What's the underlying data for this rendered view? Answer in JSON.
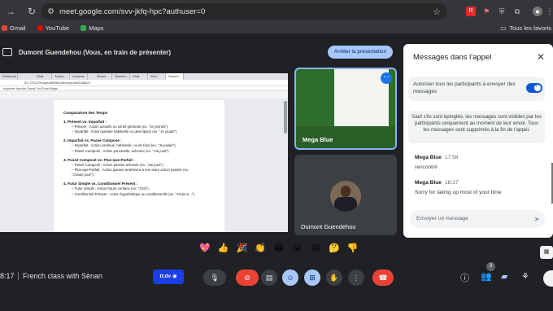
{
  "browser": {
    "url": "meet.google.com/svv-jkfq-hpc?authuser=0",
    "bookmarks": [
      {
        "label": "Gmail",
        "color": "#ea4335"
      },
      {
        "label": "YouTube",
        "color": "#ff0000"
      },
      {
        "label": "Maps",
        "color": "#34a853"
      }
    ],
    "all_bookmarks": "Tous les favoris"
  },
  "presentation": {
    "presenter_label": "Dumont Guendehou (Vous, en train de présenter)",
    "stop_button": "Arrêter la présentation"
  },
  "shared_screen": {
    "tabs": [
      "Dicebook",
      "Stud...",
      "Transl...",
      "Lessons",
      "Select...",
      "Speech...",
      "Stud...",
      "Intro",
      "Docs tr..."
    ],
    "mini_url": "ID=72IC57Ibuqes8lEfdbs3fcn4ysn5nf2Z8pluX",
    "mini_bookmarks": "Importer favoris   Gmail   YouTube   Maps",
    "doc_lines": [
      {
        "type": "h",
        "text": "Comparaison des Temps"
      },
      {
        "type": "h",
        "text": "1. Présent vs. Imparfait :"
      },
      {
        "type": "i",
        "text": "– Présent : Action actuelle ou vérité générale (ex. \"Je prends\")."
      },
      {
        "type": "i",
        "text": "– Imparfait : Action passée habituelle ou description (ex. \"Je jouais\")."
      },
      {
        "type": "h",
        "text": "2. Imparfait vs. Passé Composé :"
      },
      {
        "type": "i",
        "text": "– Imparfait : Action continue, habituelle, ou de fond (ex. \"Je jouais\")."
      },
      {
        "type": "i",
        "text": "– Passé Composé : Action ponctuelle, achevée (ex. \"J'ai joué\")."
      },
      {
        "type": "h",
        "text": "3. Passé Composé vs. Plus-que-Parfait :"
      },
      {
        "type": "i",
        "text": "– Passé Composé : Action passée achevée (ex. \"J'ai joué\")."
      },
      {
        "type": "i",
        "text": "– Plus-que-Parfait : Action passée antérieure à une autre action passée (ex."
      },
      {
        "type": "i",
        "text": "\"J'avais joué\")."
      },
      {
        "type": "h",
        "text": "4. Futur Simple vs. Conditionnel Présent :"
      },
      {
        "type": "i",
        "text": "– Futur Simple : Action future certaine (ex. \"J'irai\")."
      },
      {
        "type": "i",
        "text": "– Conditionnel Présent : Action hypothétique ou conditionnelle (ex. \"J'irais si...\")."
      }
    ]
  },
  "participants": [
    {
      "name": "Mega Blue"
    },
    {
      "name": "Dumont Guendehou"
    }
  ],
  "chat": {
    "title": "Messages dans l'appel",
    "toggle_label": "Autoriser tous les participants à envoyer des messages",
    "info": "Sauf s'ils sont épinglés, les messages sont visibles par les participants uniquement au moment de leur envoi. Tous les messages sont supprimés à la fin de l'appel.",
    "messages": [
      {
        "sender": "Mega Blue",
        "time": "17:58",
        "text": "rencontré"
      },
      {
        "sender": "Mega Blue",
        "time": "18:17",
        "text": "Sorry for taking up most of your time"
      }
    ],
    "input_placeholder": "Envoyer un message"
  },
  "reactions": [
    "💖",
    "👍",
    "🎉",
    "👏",
    "😂",
    "😮",
    "😢",
    "🤔",
    "👎"
  ],
  "meeting": {
    "time": "8:17",
    "name": "French class with Sènan",
    "participant_count": "3",
    "extension_label": "tl;dv"
  }
}
